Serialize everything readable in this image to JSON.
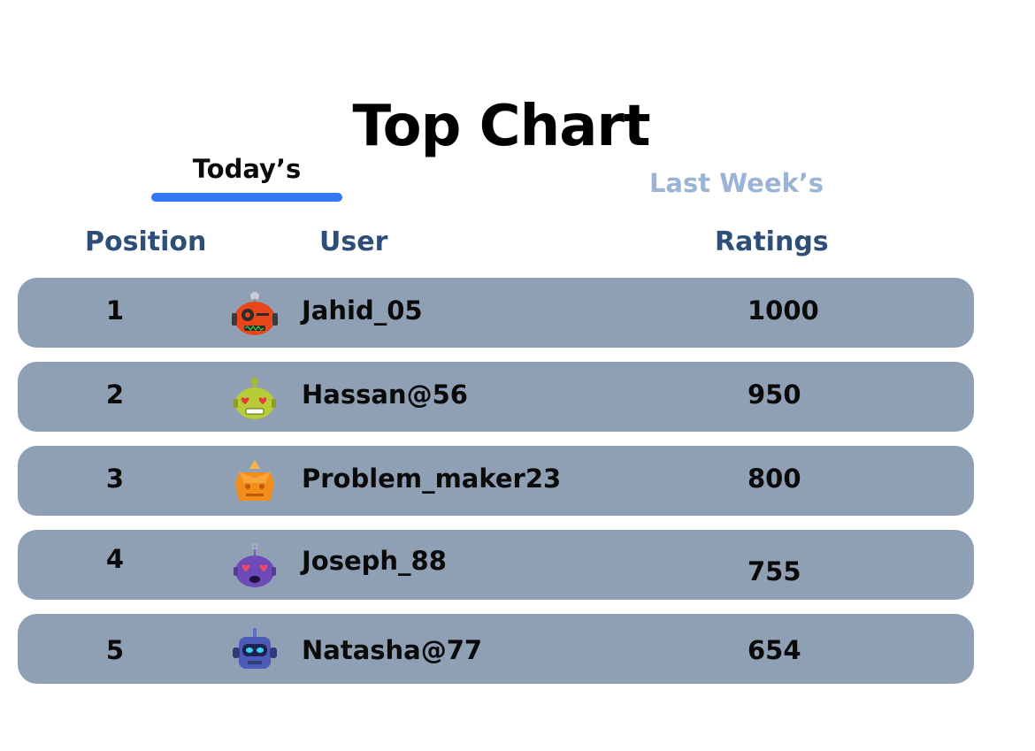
{
  "title": "Top Chart",
  "tabs": {
    "today": "Today’s",
    "last_week": "Last Week’s"
  },
  "columns": {
    "position": "Position",
    "user": "User",
    "ratings": "Ratings"
  },
  "rows": [
    {
      "position": "1",
      "user": "Jahid_05",
      "rating": "1000",
      "avatar": "orange-robot-icon"
    },
    {
      "position": "2",
      "user": "Hassan@56",
      "rating": "950",
      "avatar": "green-robot-heart-eyes-icon"
    },
    {
      "position": "3",
      "user": "Problem_maker23",
      "rating": "800",
      "avatar": "orange-crystal-robot-icon"
    },
    {
      "position": "4",
      "user": "Joseph_88",
      "rating": "755",
      "avatar": "purple-robot-heart-eyes-icon"
    },
    {
      "position": "5",
      "user": "Natasha@77",
      "rating": "654",
      "avatar": "blue-robot-icon"
    }
  ],
  "colors": {
    "accent": "#3478f6",
    "row_bg": "#8fa0b5",
    "header_text": "#2c4e78",
    "inactive_tab": "#9bb3d6"
  }
}
